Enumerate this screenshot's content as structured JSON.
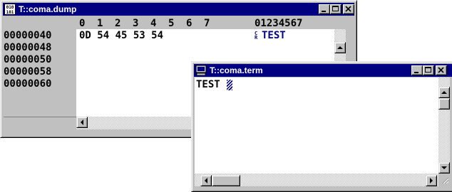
{
  "dump": {
    "title": "T::coma.dump",
    "icon": "binary-file-icon",
    "header": {
      "columns": [
        "0",
        "1",
        "2",
        "3",
        "4",
        "5",
        "6",
        "7"
      ],
      "ascii": "01234567"
    },
    "rows": [
      {
        "address": "00000040",
        "hex": "0D 54 45 53 54",
        "ascii_control": "CR",
        "ascii": "TEST"
      },
      {
        "address": "00000048",
        "hex": "",
        "ascii_control": "",
        "ascii": ""
      },
      {
        "address": "00000050",
        "hex": "",
        "ascii_control": "",
        "ascii": ""
      },
      {
        "address": "00000058",
        "hex": "",
        "ascii_control": "",
        "ascii": ""
      },
      {
        "address": "00000060",
        "hex": "",
        "ascii_control": "",
        "ascii": ""
      }
    ]
  },
  "term": {
    "title": "T::coma.term",
    "icon": "terminal-icon",
    "text": "TEST"
  },
  "colors": {
    "titlebar": "#000080",
    "window_face": "#c0c0c0",
    "ascii_text": "#000080"
  }
}
